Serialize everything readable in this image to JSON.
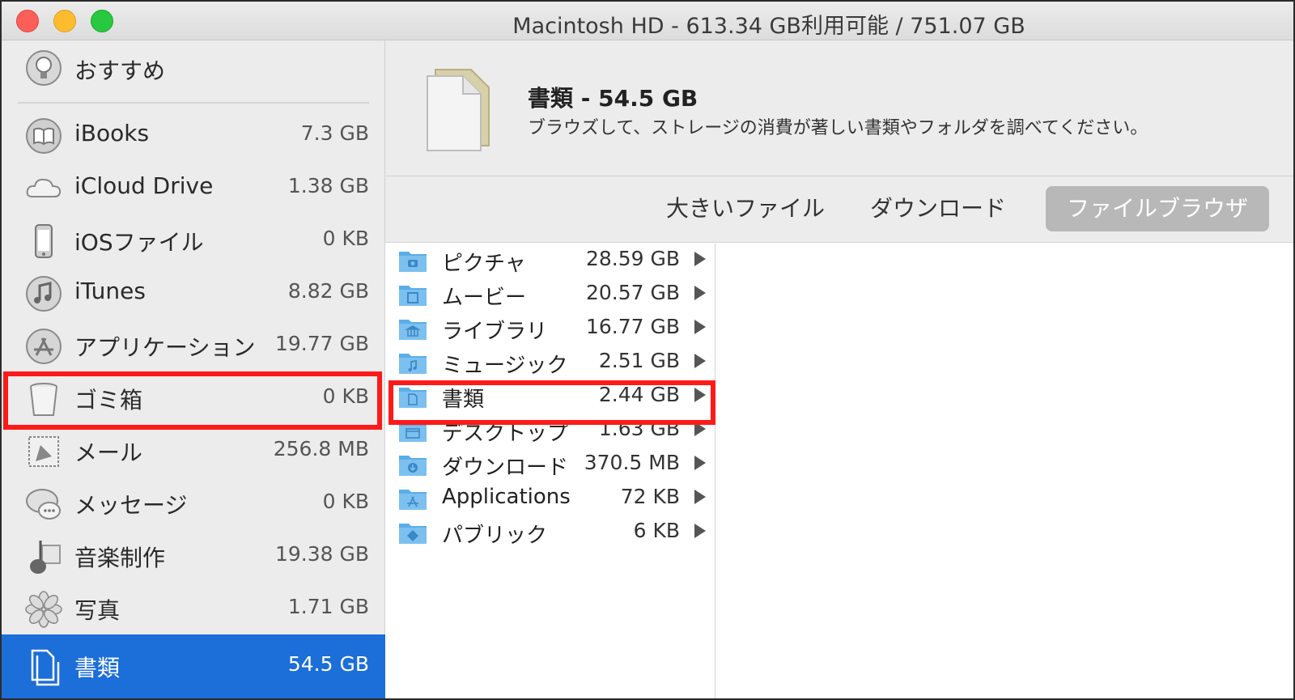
{
  "window": {
    "title": "Macintosh HD - 613.34 GB利用可能 / 751.07 GB"
  },
  "sidebar": {
    "recommend": {
      "label": "おすすめ",
      "icon": "lightbulb-icon"
    },
    "items": [
      {
        "label": "iBooks",
        "size": "7.3 GB",
        "icon": "book-icon"
      },
      {
        "label": "iCloud Drive",
        "size": "1.38 GB",
        "icon": "cloud-icon"
      },
      {
        "label": "iOSファイル",
        "size": "0 KB",
        "icon": "iphone-icon"
      },
      {
        "label": "iTunes",
        "size": "8.82 GB",
        "icon": "music-note-icon"
      },
      {
        "label": "アプリケーション",
        "size": "19.77 GB",
        "icon": "app-store-icon"
      },
      {
        "label": "ゴミ箱",
        "size": "0 KB",
        "icon": "trash-icon"
      },
      {
        "label": "メール",
        "size": "256.8 MB",
        "icon": "mail-stamp-icon"
      },
      {
        "label": "メッセージ",
        "size": "0 KB",
        "icon": "messages-icon"
      },
      {
        "label": "音楽制作",
        "size": "19.38 GB",
        "icon": "guitar-icon"
      },
      {
        "label": "写真",
        "size": "1.71 GB",
        "icon": "photos-flower-icon"
      },
      {
        "label": "書類",
        "size": "54.5 GB",
        "icon": "documents-icon"
      }
    ]
  },
  "header": {
    "title": "書類 - 54.5 GB",
    "description": "ブラウズして、ストレージの消費が著しい書類やフォルダを調べてください。"
  },
  "tabs": [
    {
      "label": "大きいファイル"
    },
    {
      "label": "ダウンロード"
    },
    {
      "label": "ファイルブラウザ",
      "active": true
    }
  ],
  "files": [
    {
      "name": "ピクチャ",
      "size": "28.59 GB",
      "icon": "camera-icon"
    },
    {
      "name": "ムービー",
      "size": "20.57 GB",
      "icon": "film-icon"
    },
    {
      "name": "ライブラリ",
      "size": "16.77 GB",
      "icon": "library-building-icon"
    },
    {
      "name": "ミュージック",
      "size": "2.51 GB",
      "icon": "music-note-icon"
    },
    {
      "name": "書類",
      "size": "2.44 GB",
      "icon": "document-icon"
    },
    {
      "name": "デスクトップ",
      "size": "1.63 GB",
      "icon": "desktop-icon"
    },
    {
      "name": "ダウンロード",
      "size": "370.5 MB",
      "icon": "download-icon"
    },
    {
      "name": "Applications",
      "size": "72 KB",
      "icon": "app-store-icon"
    },
    {
      "name": "パブリック",
      "size": "6 KB",
      "icon": "public-icon"
    }
  ],
  "colors": {
    "selection": "#1c6ed8",
    "highlight": "#ff1a1a",
    "folder": "#5aaee8"
  }
}
